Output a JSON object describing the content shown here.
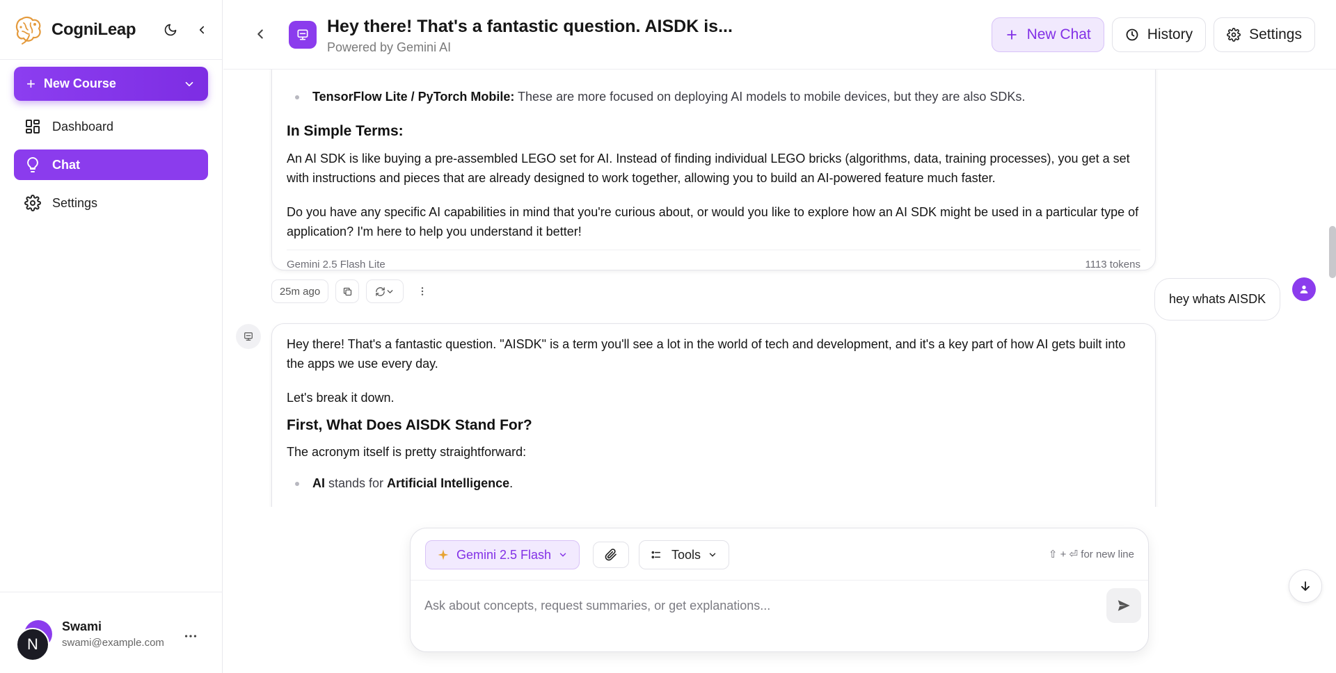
{
  "app": {
    "name": "CogniLeap"
  },
  "sidebar": {
    "new_course_label": "New Course",
    "nav": [
      {
        "label": "Dashboard",
        "icon": "dashboard-icon",
        "active": false
      },
      {
        "label": "Chat",
        "icon": "lightbulb-icon",
        "active": true
      },
      {
        "label": "Settings",
        "icon": "gear-icon",
        "active": false
      }
    ],
    "user": {
      "initial": "N",
      "name": "Swami",
      "email": "swami@example.com"
    }
  },
  "header": {
    "title": "Hey there! That's a fantastic question. AISDK is...",
    "subtitle": "Powered by Gemini AI",
    "new_chat_label": "New Chat",
    "history_label": "History",
    "settings_label": "Settings"
  },
  "messages": {
    "first": {
      "bullet_bold": "TensorFlow Lite / PyTorch Mobile:",
      "bullet_rest": " These are more focused on deploying AI models to mobile devices, but they are also SDKs.",
      "heading": "In Simple Terms:",
      "para1": "An AI SDK is like buying a pre-assembled LEGO set for AI. Instead of finding individual LEGO bricks (algorithms, data, training processes), you get a set with instructions and pieces that are already designed to work together, allowing you to build an AI-powered feature much faster.",
      "para2": "Do you have any specific AI capabilities in mind that you're curious about, or would you like to explore how an AI SDK might be used in a particular type of application? I'm here to help you understand it better!",
      "model": "Gemini 2.5 Flash Lite",
      "tokens": "1113 tokens",
      "time": "25m ago"
    },
    "user_message": "hey whats AISDK",
    "second": {
      "para1": "Hey there! That's a fantastic question. \"AISDK\" is a term you'll see a lot in the world of tech and development, and it's a key part of how AI gets built into the apps we use every day.",
      "para2": "Let's break it down.",
      "heading": "First, What Does AISDK Stand For?",
      "para3": "The acronym itself is pretty straightforward:",
      "bullet_bold1": "AI",
      "bullet_mid": " stands for ",
      "bullet_bold2": "Artificial Intelligence",
      "bullet_end": "."
    }
  },
  "composer": {
    "model_label": "Gemini 2.5 Flash",
    "tools_label": "Tools",
    "hint": "⇧ + ⏎ for new line",
    "placeholder": "Ask about concepts, request summaries, or get explanations..."
  },
  "colors": {
    "accent": "#8b3ced",
    "accent_light": "#f1e9fd"
  }
}
